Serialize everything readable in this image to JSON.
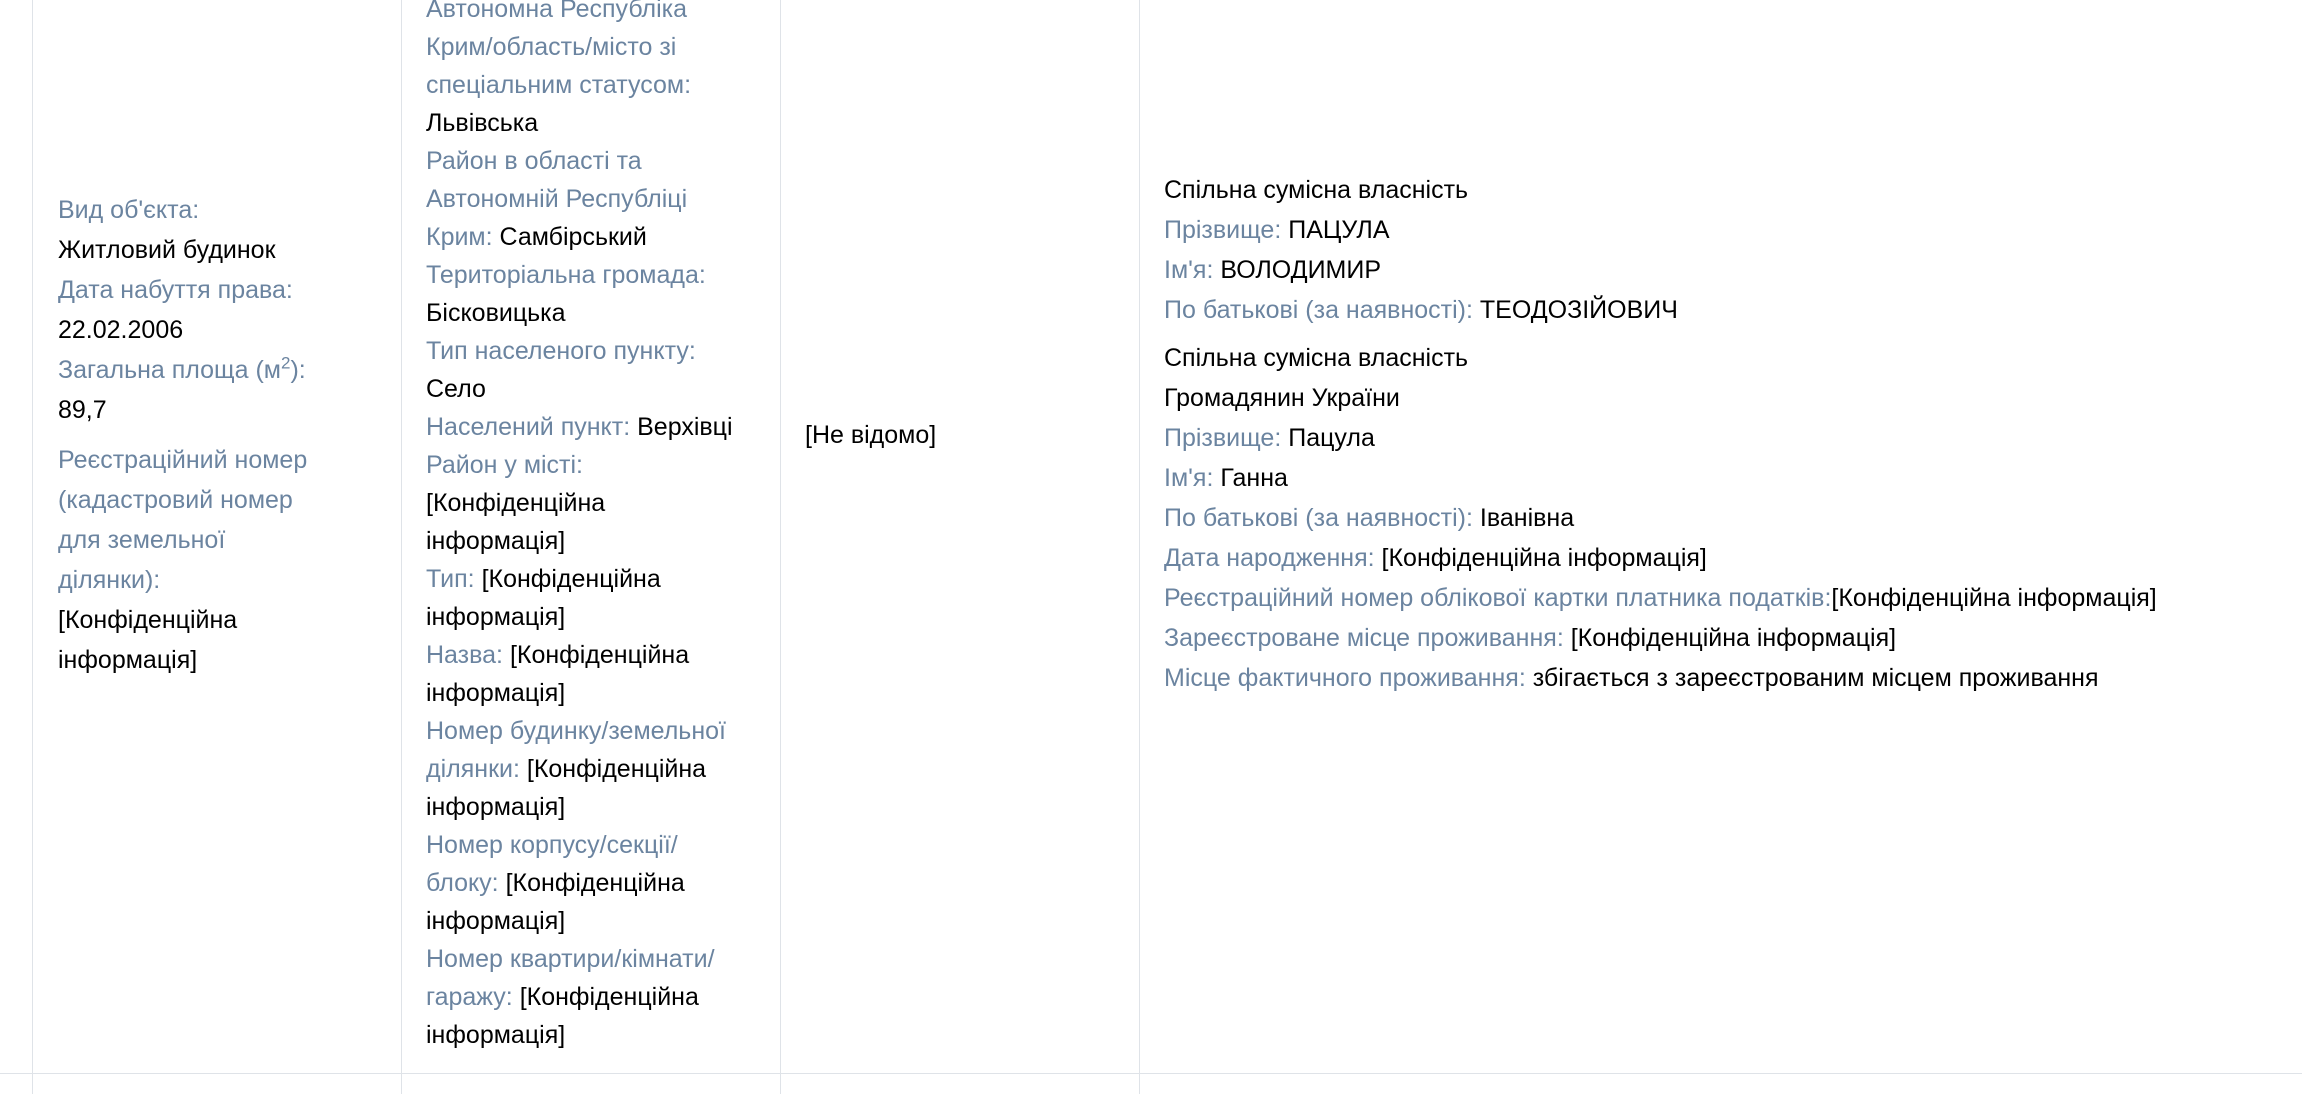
{
  "object": {
    "type_label": "Вид об'єкта:",
    "type_value": "Житловий будинок",
    "date_label": "Дата набуття права:",
    "date_value": "22.02.2006",
    "area_label_pre": "Загальна площа (м",
    "area_label_sup": "2",
    "area_label_post": "):",
    "area_value": "89,7",
    "regnum_label_1": "Реєстраційний номер",
    "regnum_label_2": "(кадастровий номер",
    "regnum_label_3": "для земельної",
    "regnum_label_4": "ділянки):",
    "regnum_value_1": "[Конфіденційна",
    "regnum_value_2": "інформація]"
  },
  "address": {
    "region_label_1": "Автономна Республіка",
    "region_label_2": "Крим/область/місто зі",
    "region_label_3": "спеціальним статусом:",
    "region_value": "Львівська",
    "district_label_1": "Район в області та",
    "district_label_2": "Автономній Республіці",
    "district_label_3": "Крим:",
    "district_value": "Самбірський",
    "community_label": "Територіальна громада:",
    "community_value": "Бісковицька",
    "settlement_type_label": "Тип населеного пункту:",
    "settlement_type_value": "Село",
    "settlement_label": "Населений пункт:",
    "settlement_value": "Верхівці",
    "city_district_label": "Район у місті:",
    "city_district_value_1": "[Конфіденційна",
    "city_district_value_2": "інформація]",
    "street_type_label": "Тип:",
    "street_type_value_1": "[Конфіденційна",
    "street_type_value_2": "інформація]",
    "street_name_label": "Назва:",
    "street_name_value_1": "[Конфіденційна",
    "street_name_value_2": "інформація]",
    "house_label_1": "Номер будинку/земельної",
    "house_label_2": "ділянки:",
    "house_value_1": "[Конфіденційна",
    "house_value_2": "інформація]",
    "building_label_1": "Номер корпусу/секції/",
    "building_label_2": "блоку:",
    "building_value_1": "[Конфіденційна",
    "building_value_2": "інформація]",
    "apartment_label_1": "Номер квартири/кімнати/",
    "apartment_label_2": "гаражу:",
    "apartment_value_1": "[Конфіденційна",
    "apartment_value_2": "інформація]"
  },
  "cost": {
    "value": "[Не відомо]"
  },
  "owners": [
    {
      "ownership": "Спільна сумісна власність",
      "surname_label": "Прізвище:",
      "surname_value": "ПАЦУЛА",
      "name_label": "Ім'я:",
      "name_value": "ВОЛОДИМИР",
      "patronymic_label": "По батькові (за наявності):",
      "patronymic_value": "ТЕОДОЗІЙОВИЧ"
    },
    {
      "ownership": "Спільна сумісна власність",
      "citizenship": "Громадянин України",
      "surname_label": "Прізвище:",
      "surname_value": "Пацула",
      "name_label": "Ім'я:",
      "name_value": "Ганна",
      "patronymic_label": "По батькові (за наявності):",
      "patronymic_value": "Іванівна",
      "birth_label": "Дата народження:",
      "birth_value": "[Конфіденційна інформація]",
      "tax_label": "Реєстраційний номер облікової картки платника податків:",
      "tax_value": "[Конфіденційна інформація]",
      "reg_address_label": "Зареєстроване місце проживання:",
      "reg_address_value": "[Конфіденційна інформація]",
      "actual_address_label": "Місце фактичного проживання:",
      "actual_address_value": "збігається з зареєстрованим місцем проживання"
    }
  ]
}
